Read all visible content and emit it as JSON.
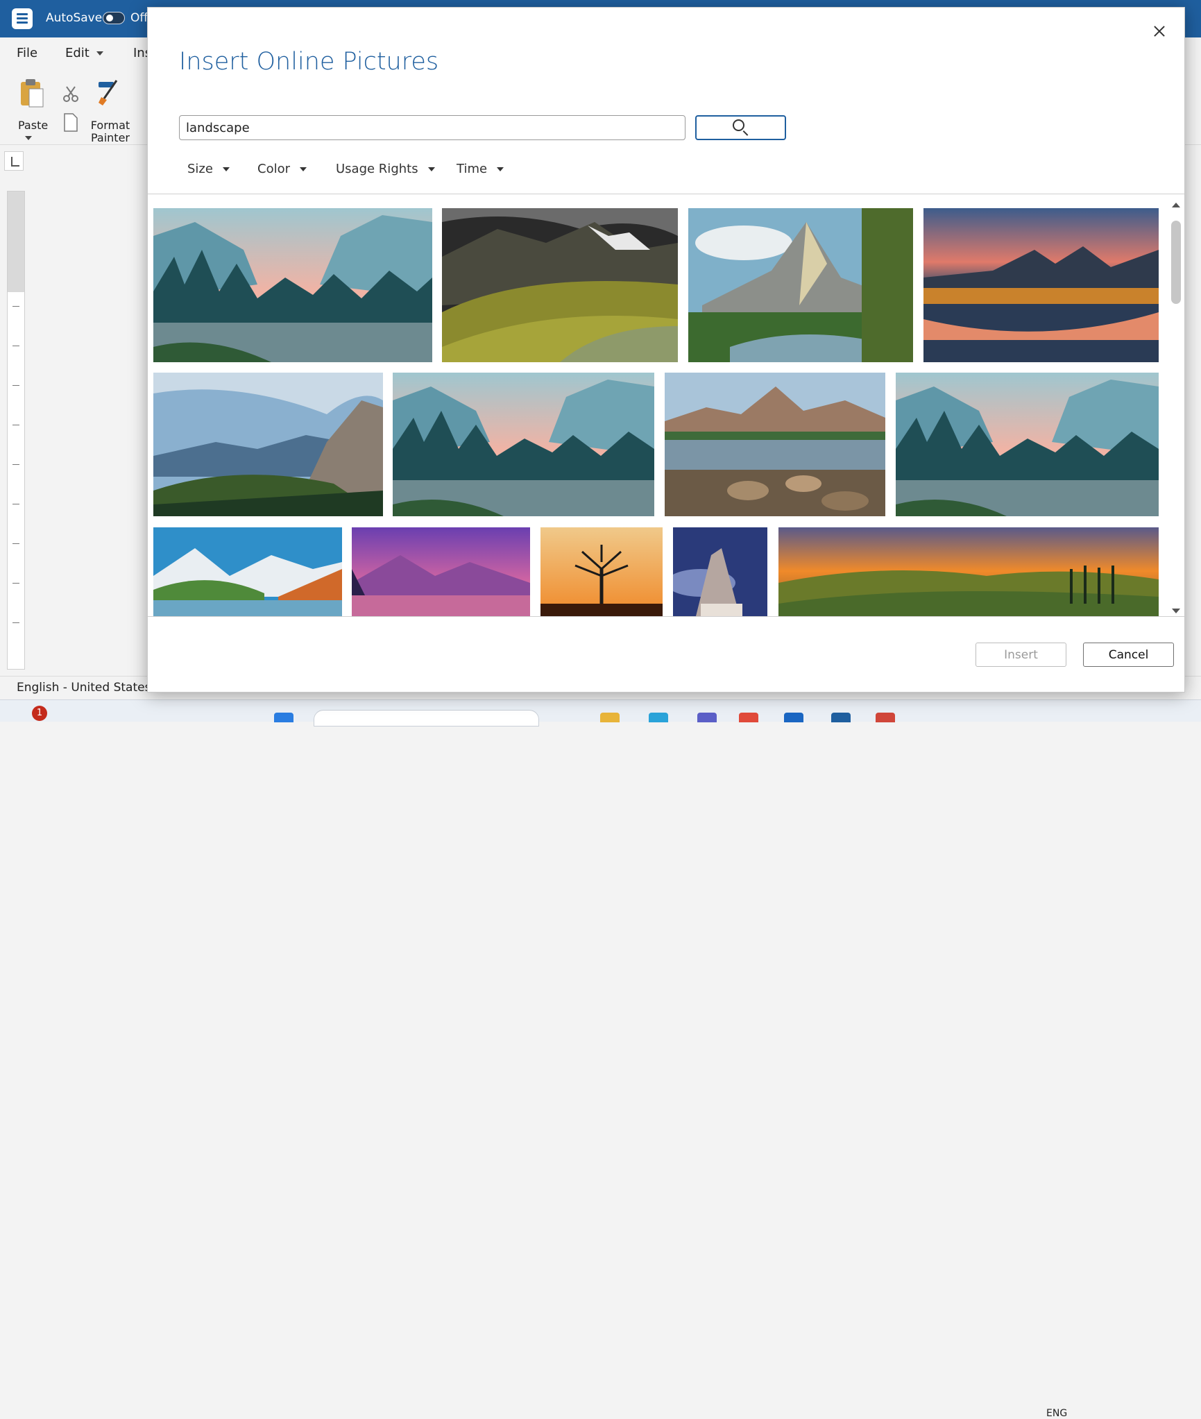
{
  "window": {
    "autosave_label": "AutoSave",
    "autosave_state": "Off",
    "accent_color": "#1f5f9f"
  },
  "menubar": {
    "items": [
      "File",
      "Edit",
      "Ins"
    ]
  },
  "ribbon": {
    "paste_label": "Paste",
    "format_painter_label": "Format Painter"
  },
  "statusbar": {
    "language": "English - United States"
  },
  "taskbar": {
    "notification_count": "1",
    "language": "ENG"
  },
  "dialog": {
    "title": "Insert Online Pictures",
    "search_value": "landscape",
    "filters": [
      "Size",
      "Color",
      "Usage Rights",
      "Time"
    ],
    "insert_label": "Insert",
    "cancel_label": "Cancel",
    "results": [
      {
        "name": "yosemite-valley-river",
        "icon": "image-icon"
      },
      {
        "name": "green-mountain-valley",
        "icon": "image-icon"
      },
      {
        "name": "painted-mountain-stream",
        "icon": "image-icon"
      },
      {
        "name": "sunset-lake-reflection",
        "icon": "image-icon"
      },
      {
        "name": "alpine-valley-peak",
        "icon": "image-icon"
      },
      {
        "name": "yosemite-valley-river-2",
        "icon": "image-icon"
      },
      {
        "name": "mountain-lake-stones",
        "icon": "image-icon"
      },
      {
        "name": "yosemite-valley-river-3",
        "icon": "image-icon"
      },
      {
        "name": "mountain-lake-blue",
        "icon": "image-icon"
      },
      {
        "name": "purple-sunset-mountains",
        "icon": "image-icon"
      },
      {
        "name": "tree-silhouette-sunset",
        "icon": "image-icon"
      },
      {
        "name": "misty-peak-cabin",
        "icon": "image-icon"
      },
      {
        "name": "tuscany-hills-sunset",
        "icon": "image-icon"
      }
    ]
  }
}
